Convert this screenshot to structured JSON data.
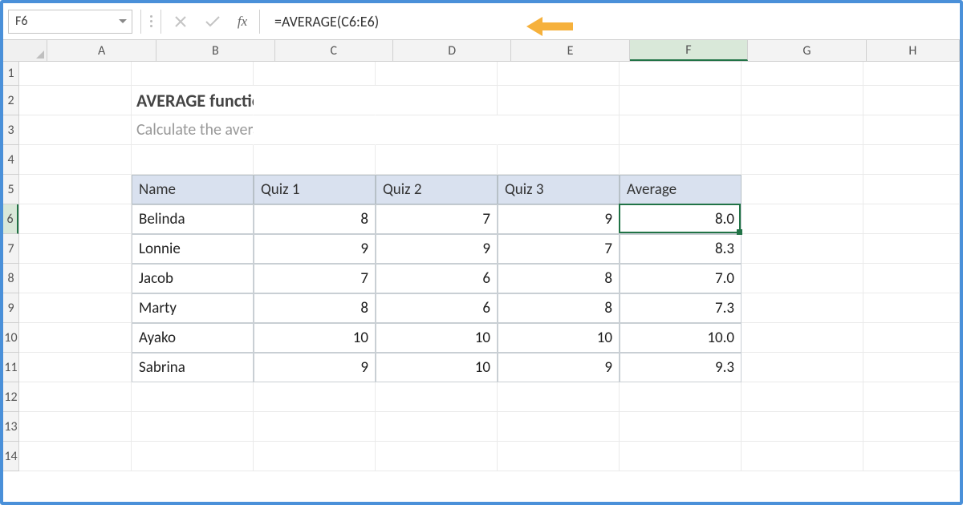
{
  "name_box": "F6",
  "formula": "=AVERAGE(C6:E6)",
  "fx_label": "fx",
  "columns": [
    "A",
    "B",
    "C",
    "D",
    "E",
    "F",
    "G",
    "H"
  ],
  "rows": [
    1,
    2,
    3,
    4,
    5,
    6,
    7,
    8,
    9,
    10,
    11,
    12,
    13,
    14
  ],
  "active": {
    "col": "F",
    "row": 6
  },
  "title": "AVERAGE function",
  "subtitle": "Calculate the average of supplied numbers",
  "table": {
    "headers": [
      "Name",
      "Quiz 1",
      "Quiz 2",
      "Quiz 3",
      "Average"
    ],
    "rows": [
      {
        "name": "Belinda",
        "q1": 8,
        "q2": 7,
        "q3": 9,
        "avg": "8.0"
      },
      {
        "name": "Lonnie",
        "q1": 9,
        "q2": 9,
        "q3": 7,
        "avg": "8.3"
      },
      {
        "name": "Jacob",
        "q1": 7,
        "q2": 6,
        "q3": 8,
        "avg": "7.0"
      },
      {
        "name": "Marty",
        "q1": 8,
        "q2": 6,
        "q3": 8,
        "avg": "7.3"
      },
      {
        "name": "Ayako",
        "q1": 10,
        "q2": 10,
        "q3": 10,
        "avg": "10.0"
      },
      {
        "name": "Sabrina",
        "q1": 9,
        "q2": 10,
        "q3": 9,
        "avg": "9.3"
      }
    ]
  },
  "row_heights": {
    "default": 37,
    "r1": 30
  },
  "col_widths": {
    "A": 140,
    "B": 152,
    "C": 152,
    "D": 152,
    "E": 152,
    "F": 152,
    "G": 152,
    "H": 120
  }
}
